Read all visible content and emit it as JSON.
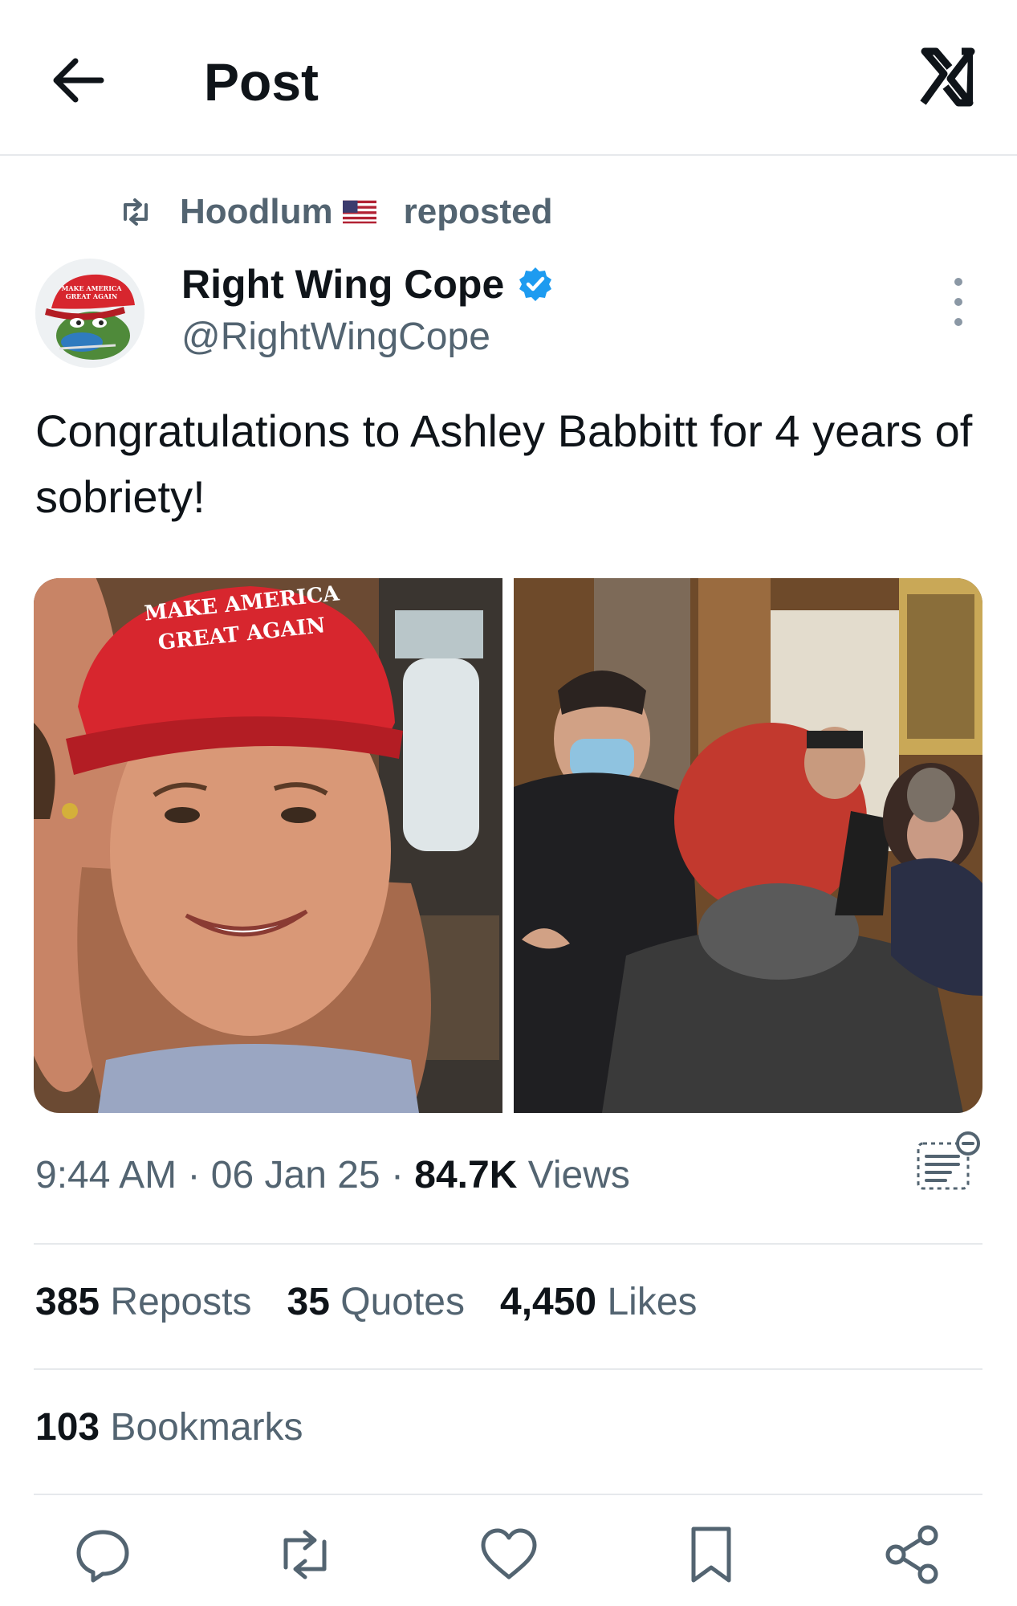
{
  "header": {
    "title": "Post",
    "back_icon": "arrow-left-icon",
    "brand_icon": "x-logo-icon"
  },
  "repost": {
    "user": "Hoodlum",
    "flag_icon": "us-flag-icon",
    "suffix": "reposted"
  },
  "author": {
    "name": "Right Wing Cope",
    "handle": "@RightWingCope",
    "verified": true,
    "avatar_cap_text": "MAKE AMERICA GREAT AGAIN"
  },
  "post": {
    "text": "Congratulations to Ashley Babbitt for 4 years of sobriety!",
    "images": [
      {
        "hat_text": "MAKE AMERICA GREAT AGAIN"
      },
      {
        "description_icon": "photo-icon"
      }
    ]
  },
  "meta": {
    "time": "9:44 AM",
    "sep1": " · ",
    "date": "06 Jan 25",
    "sep2": " · ",
    "views_count": "84.7K",
    "views_label": " Views"
  },
  "stats": {
    "reposts_count": "385",
    "reposts_label": " Reposts",
    "quotes_count": "35",
    "quotes_label": " Quotes",
    "likes_count": "4,450",
    "likes_label": " Likes",
    "bookmarks_count": "103",
    "bookmarks_label": " Bookmarks"
  },
  "colors": {
    "text": "#0f1419",
    "secondary": "#536471",
    "verified": "#1d9bf0",
    "divider": "#e6e9ec",
    "hat_red": "#d7262e"
  }
}
